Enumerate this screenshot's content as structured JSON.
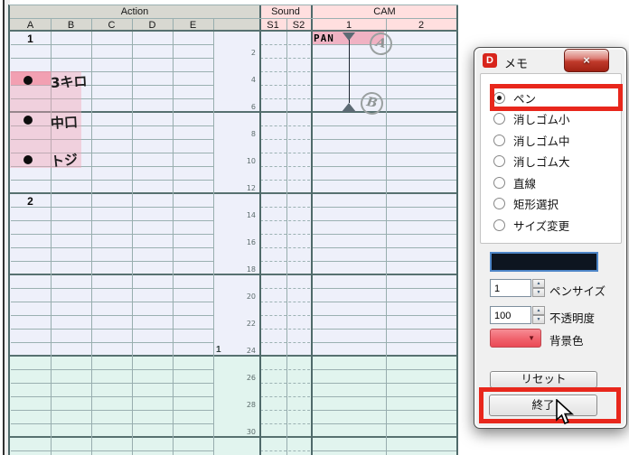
{
  "sheet": {
    "header": {
      "action": "Action",
      "sound": "Sound",
      "cam": "CAM",
      "action_cols": [
        "A",
        "B",
        "C",
        "D",
        "E"
      ],
      "sound_cols": [
        "S1",
        "S2"
      ],
      "cam_cols": [
        "1",
        "2"
      ]
    },
    "frame_numbers": [
      "2",
      "4",
      "6",
      "8",
      "10",
      "12",
      "14",
      "16",
      "18",
      "20",
      "22",
      "24",
      "26",
      "28",
      "30"
    ],
    "cut_markers": [
      {
        "label": "1",
        "row": 1
      },
      {
        "label": "2",
        "row": 13
      }
    ],
    "second_marker": "1",
    "cam_pan": {
      "label": "PAN",
      "circled_marks": [
        "A",
        "B"
      ]
    },
    "memo_notes": [
      {
        "text": "3キロ",
        "row": 4
      },
      {
        "text": "中口",
        "row": 7
      },
      {
        "text": "トジ",
        "row": 10
      }
    ],
    "colors": {
      "body_upper": "#eef0fa",
      "body_lower": "#e1f4ee",
      "header_gray": "#d8d8d1",
      "header_pink": "#ffdfdf",
      "memo_pink": "#f6a9b8",
      "annotation_red": "#e8271c"
    }
  },
  "dialog": {
    "title": "メモ",
    "icon_glyph": "D",
    "close_icon_glyph": "×",
    "tools": [
      {
        "label": "ペン",
        "selected": true
      },
      {
        "label": "消しゴム小",
        "selected": false
      },
      {
        "label": "消しゴム中",
        "selected": false
      },
      {
        "label": "消しゴム大",
        "selected": false
      },
      {
        "label": "直線",
        "selected": false
      },
      {
        "label": "矩形選択",
        "selected": false
      },
      {
        "label": "サイズ変更",
        "selected": false
      }
    ],
    "pen_color": "#0d1520",
    "pen_size": {
      "value": "1",
      "label": "ペンサイズ"
    },
    "opacity": {
      "value": "100",
      "label": "不透明度"
    },
    "background_color": {
      "label": "背景色",
      "swatch": "#f2727b"
    },
    "reset_label": "リセット",
    "exit_label": "終了"
  }
}
